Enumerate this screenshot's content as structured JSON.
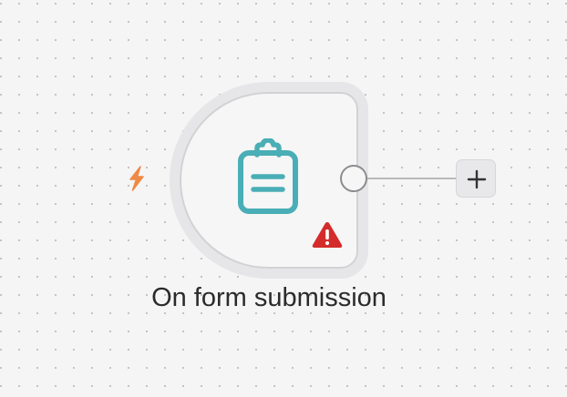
{
  "node": {
    "label": "On form submission",
    "icon": "clipboard-icon",
    "trigger_icon": "lightning-bolt-icon",
    "status_icon": "warning-triangle-icon"
  },
  "connector": {
    "add_icon": "plus-icon"
  },
  "colors": {
    "canvas_background": "#f5f5f5",
    "canvas_dots": "#c2c2c6",
    "node_icon": "#4aaeb6",
    "trigger_icon": "#ee8a45",
    "warning_icon": "#d42b2b",
    "label_text": "#2b2b2d"
  }
}
